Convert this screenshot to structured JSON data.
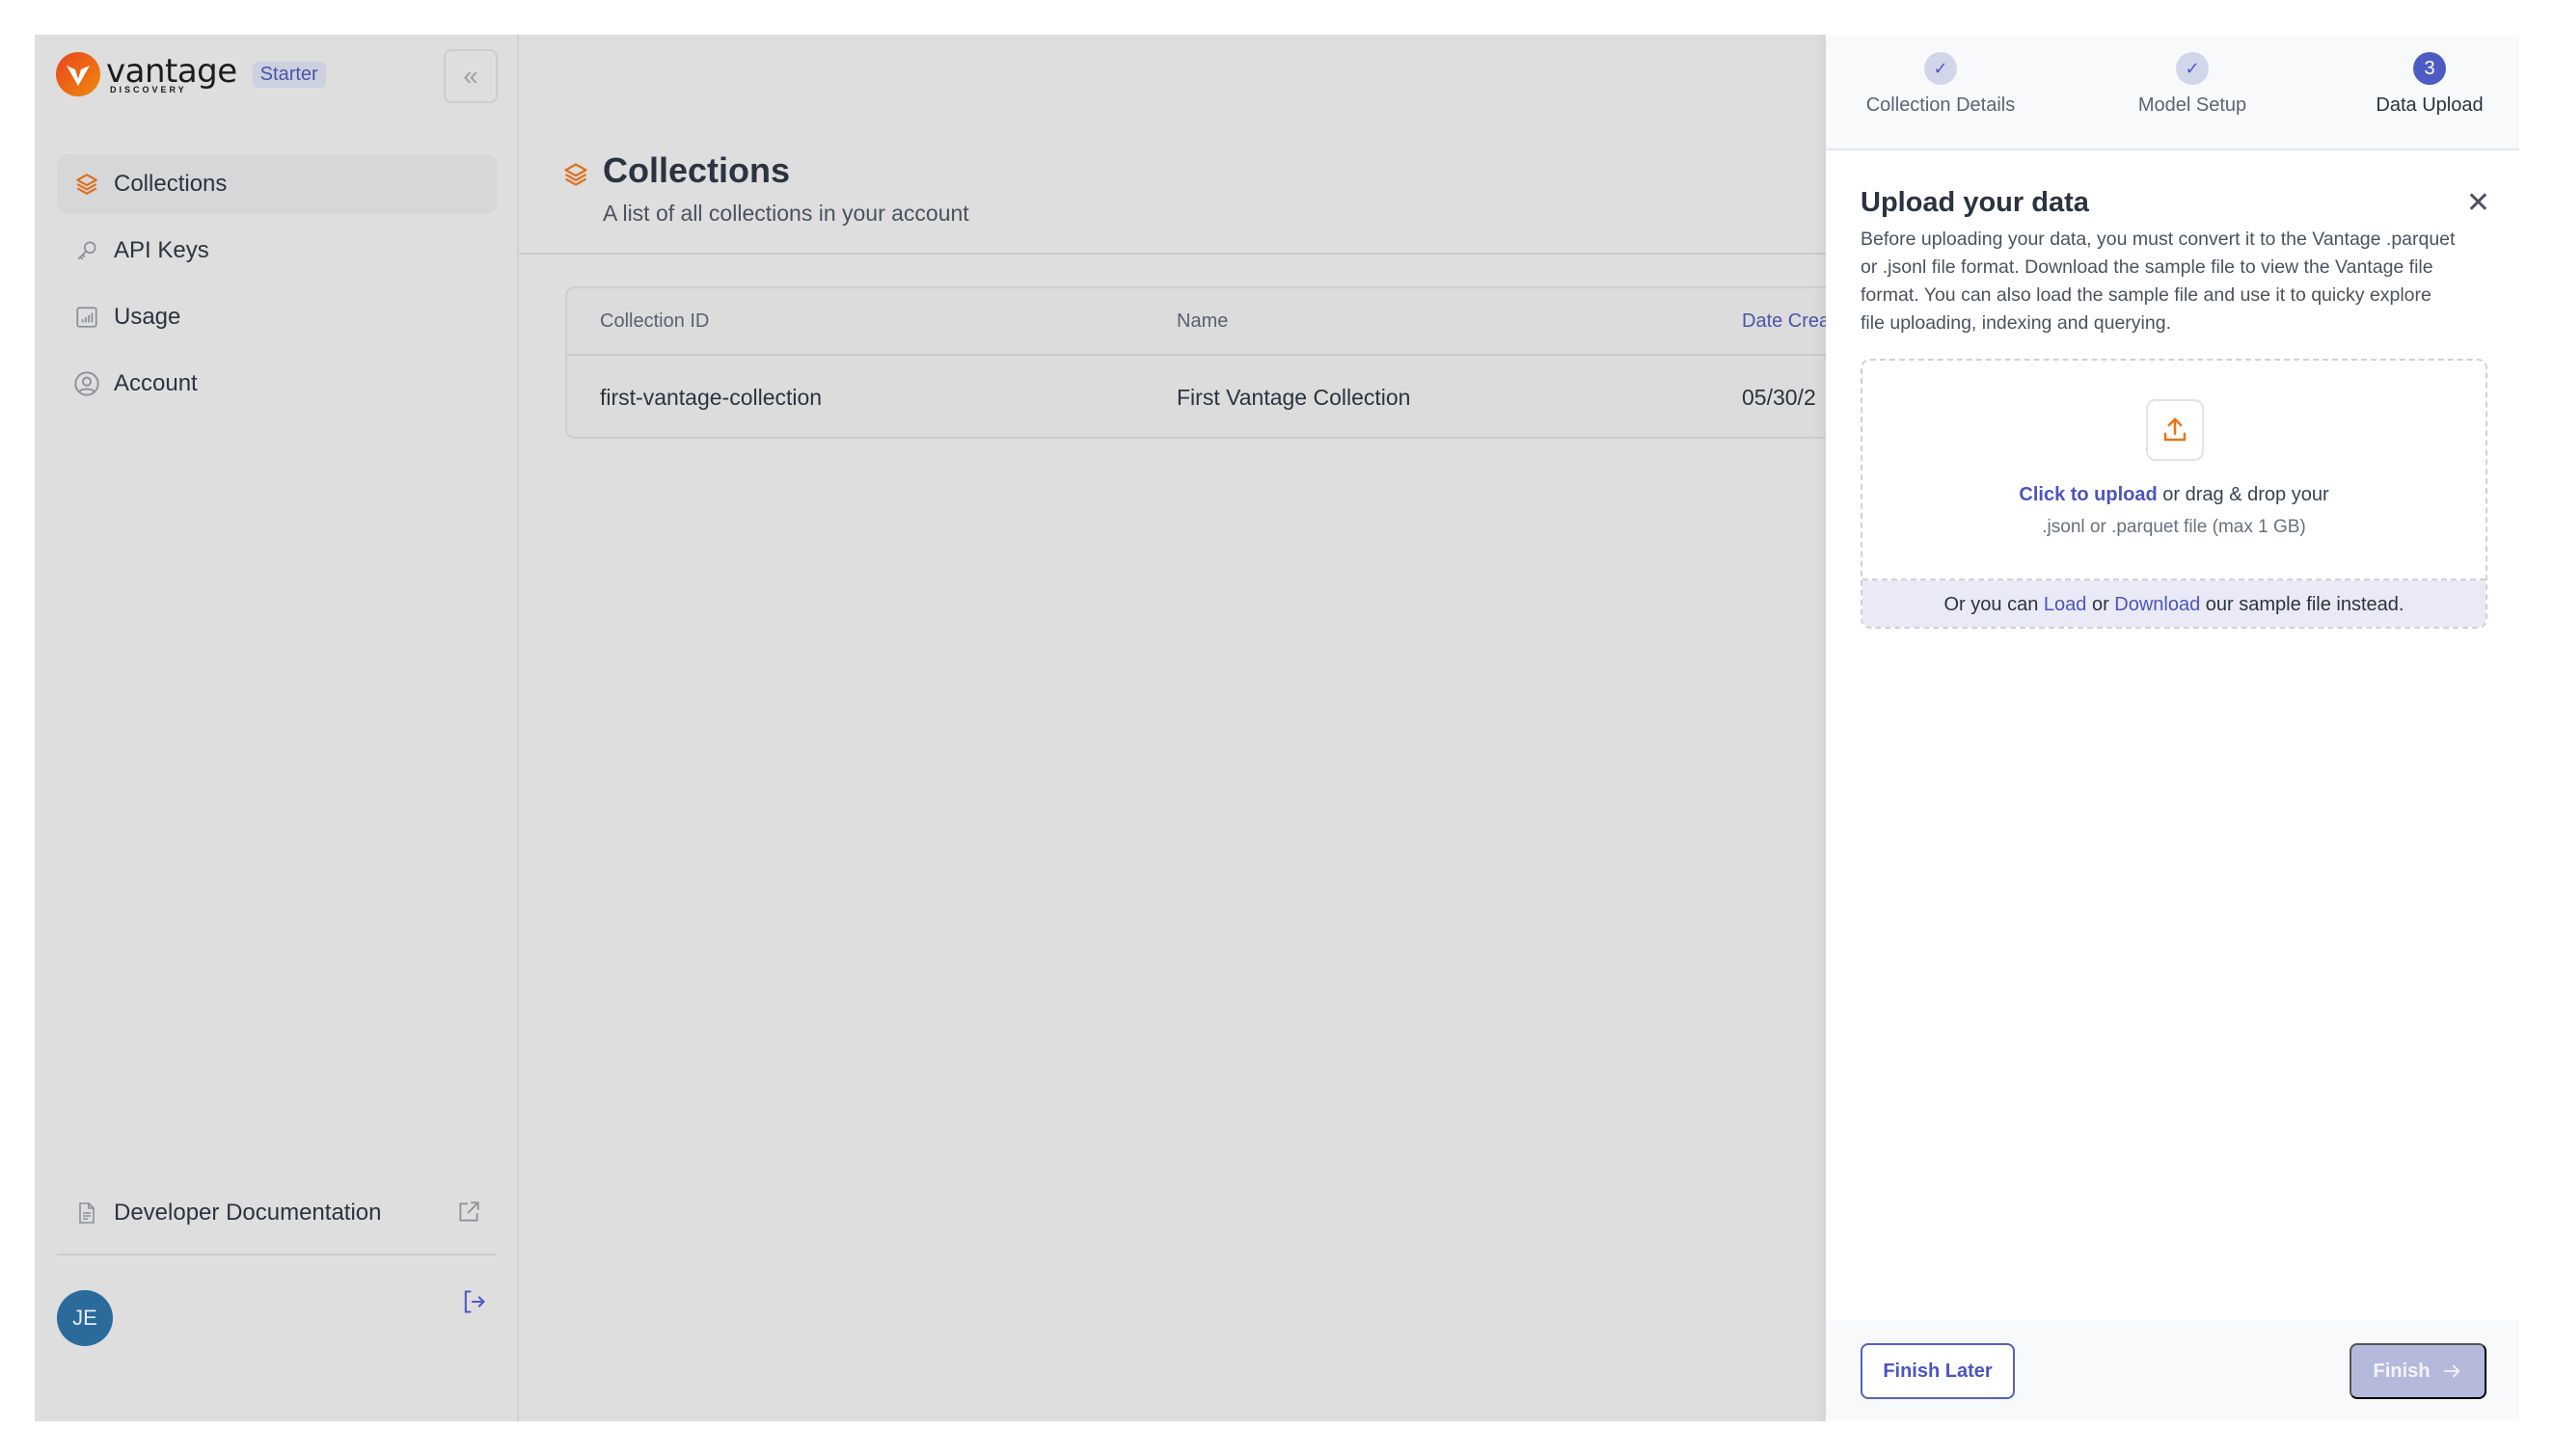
{
  "app": {
    "brand_name": "vantage",
    "brand_sub": "DISCOVERY",
    "plan_badge": "Starter",
    "brand_colors": {
      "orange": "#e8441e",
      "accent": "#4e5bc4"
    }
  },
  "sidebar": {
    "collapse_icon": "double-chevron-left-icon",
    "items": [
      {
        "label": "Collections",
        "icon": "layers-icon",
        "active": true
      },
      {
        "label": "API Keys",
        "icon": "key-icon",
        "active": false
      },
      {
        "label": "Usage",
        "icon": "bar-chart-icon",
        "active": false
      },
      {
        "label": "Account",
        "icon": "user-circle-icon",
        "active": false
      }
    ],
    "docs_link": {
      "label": "Developer Documentation",
      "icon": "document-icon",
      "trailing_icon": "external-link-icon"
    },
    "user": {
      "initials": "JE",
      "avatar_color": "#2a6b9c"
    },
    "logout_icon": "logout-icon"
  },
  "main": {
    "title": "Collections",
    "subtitle": "A list of all collections in your account",
    "table": {
      "columns": [
        "Collection ID",
        "Name",
        "Date Crea"
      ],
      "rows": [
        {
          "collection_id": "first-vantage-collection",
          "name": "First Vantage Collection",
          "date": "05/30/2"
        }
      ]
    }
  },
  "panel": {
    "steps": [
      {
        "label": "Collection Details",
        "state": "done",
        "marker": "✓"
      },
      {
        "label": "Model Setup",
        "state": "done",
        "marker": "✓"
      },
      {
        "label": "Data Upload",
        "state": "current",
        "marker": "3"
      }
    ],
    "title": "Upload your data",
    "description": "Before uploading your data, you must convert it to the Vantage .parquet or .jsonl file format. Download the sample file to view the Vantage file format. You can also load the sample file and use it to quicky explore file uploading, indexing and querying.",
    "dropzone": {
      "click_label": "Click to upload",
      "drag_text": " or drag & drop your",
      "hint": ".jsonl or .parquet file (max 1 GB)",
      "footer_prefix": "Or you can ",
      "load_label": "Load",
      "or_text": " or ",
      "download_label": "Download",
      "footer_suffix": " our sample file instead."
    },
    "buttons": {
      "finish_later": "Finish Later",
      "finish": "Finish"
    }
  }
}
